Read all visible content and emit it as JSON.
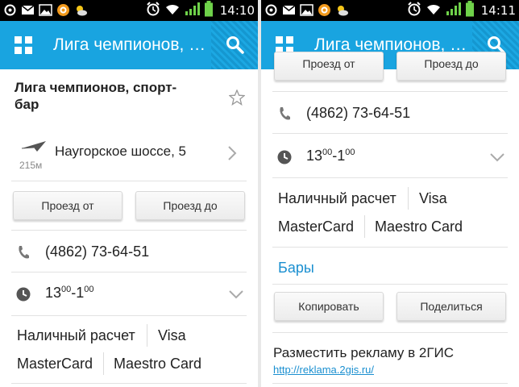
{
  "left": {
    "status": {
      "time": "14:10"
    },
    "app_bar": {
      "title": "Лига чемпионов, с..."
    },
    "place": {
      "name": "Лига чемпионов, спорт-бар",
      "address": "Наугорское шоссе, 5",
      "distance": "215м"
    },
    "buttons": {
      "route_from": "Проезд от",
      "route_to": "Проезд до"
    },
    "phone": "(4862) 73-64-51",
    "hours": {
      "open": "13",
      "open_min": "00",
      "sep": "-",
      "close": "1",
      "close_min": "00"
    },
    "payment": {
      "cash": "Наличный расчет",
      "visa": "Visa",
      "mastercard": "MasterCard",
      "maestro": "Maestro Card"
    }
  },
  "right": {
    "status": {
      "time": "14:11"
    },
    "app_bar": {
      "title": "Лига чемпионов, с..."
    },
    "buttons": {
      "route_from": "Проезд от",
      "route_to": "Проезд до",
      "copy": "Копировать",
      "share": "Поделиться"
    },
    "phone": "(4862) 73-64-51",
    "hours": {
      "open": "13",
      "open_min": "00",
      "sep": "-",
      "close": "1",
      "close_min": "00"
    },
    "payment": {
      "cash": "Наличный расчет",
      "visa": "Visa",
      "mastercard": "MasterCard",
      "maestro": "Maestro Card"
    },
    "category": "Бары",
    "ad": {
      "title": "Разместить рекламу в 2ГИС",
      "link": "http://reklama.2gis.ru/"
    }
  },
  "colors": {
    "accent": "#19a4e0",
    "status_bar": "#000000",
    "link": "#1a8fd0"
  },
  "icons": [
    "location-icon",
    "mail-icon",
    "image-icon",
    "app-icon",
    "weather-icon",
    "alarm-icon",
    "wifi-icon",
    "signal-icon",
    "battery-icon",
    "grid-icon",
    "search-icon",
    "star-icon",
    "direction-arrow-icon",
    "chevron-right-icon",
    "phone-icon",
    "clock-icon",
    "chevron-down-icon"
  ]
}
